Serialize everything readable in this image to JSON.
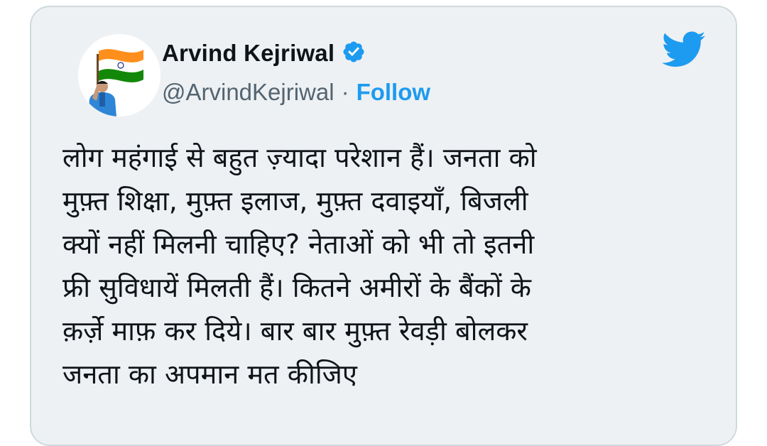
{
  "tweet": {
    "author_name": "Arvind Kejriwal",
    "author_handle": "@ArvindKejriwal",
    "separator": "·",
    "follow_label": "Follow",
    "verified": true,
    "text_lines": [
      "लोग महंगाई से बहुत ज़्यादा परेशान हैं। जनता को",
      "मुफ़्त शिक्षा, मुफ़्त इलाज, मुफ़्त दवाइयाँ, बिजली",
      "क्यों नहीं मिलनी चाहिए? नेताओं को भी तो इतनी",
      "फ्री सुविधायें मिलती हैं। कितने अमीरों के बैंकों के",
      "क़र्ज़े माफ़ कर दिये। बार बार मुफ़्त रेवड़ी बोलकर",
      "जनता का अपमान मत कीजिए"
    ]
  },
  "icons": {
    "verified": "verified-badge-icon",
    "brand": "twitter-bird-icon"
  },
  "colors": {
    "card_bg": "#eef1f3",
    "card_border": "#cfd9de",
    "accent_blue": "#1d9bf0",
    "text_primary": "#0f1419",
    "text_secondary": "#536471"
  }
}
